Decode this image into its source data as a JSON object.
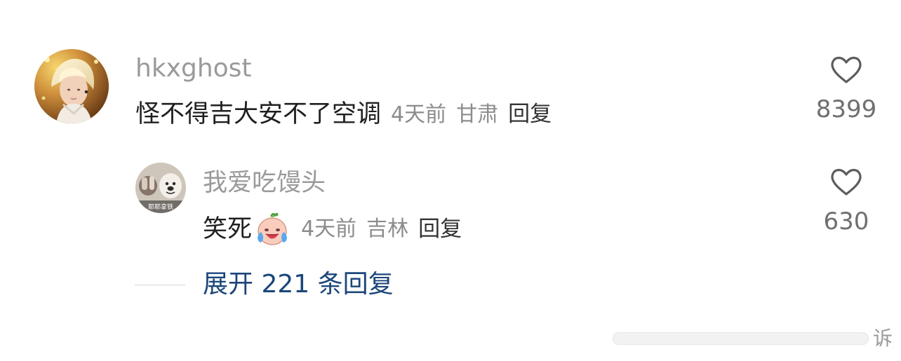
{
  "comments": [
    {
      "username": "hkxghost",
      "text": "怪不得吉大安不了空调",
      "time": "4天前",
      "location": "甘肃",
      "reply_label": "回复",
      "like_count": "8399",
      "avatar_icon": "profile-avatar"
    },
    {
      "username": "我爱吃馒头",
      "text": "笑死",
      "emoji_icon": "laughing-crying-emoji",
      "time": "4天前",
      "location": "吉林",
      "reply_label": "回复",
      "like_count": "630",
      "avatar_icon": "dog-avatar",
      "avatar_text": "耶耶拿铁"
    }
  ],
  "expand": {
    "label": "展开 221 条回复"
  },
  "watermark": {
    "text": "诉"
  },
  "colors": {
    "username": "#9a9a9a",
    "meta": "#8c8c8c",
    "expand": "#1b467a",
    "heart": "#5d5d5d"
  }
}
